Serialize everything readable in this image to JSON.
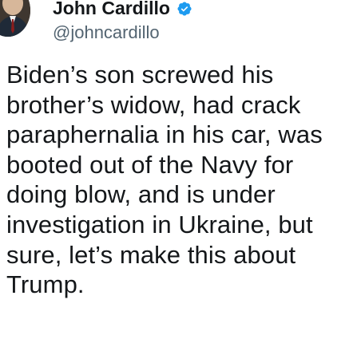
{
  "tweet": {
    "author": {
      "display_name": "John Cardillo",
      "handle": "@johncardillo",
      "avatar_icon": "profile-photo-icon",
      "verified_icon": "verified-badge-icon",
      "verified_color": "#1d9bf0"
    },
    "text": "Biden’s son screwed his\nbrother’s widow, had crack\nparaphernalia in his car, was\nbooted out of the Navy for\ndoing blow, and is under\ninvestigation in Ukraine, but\nsure, let’s make this about\nTrump."
  }
}
